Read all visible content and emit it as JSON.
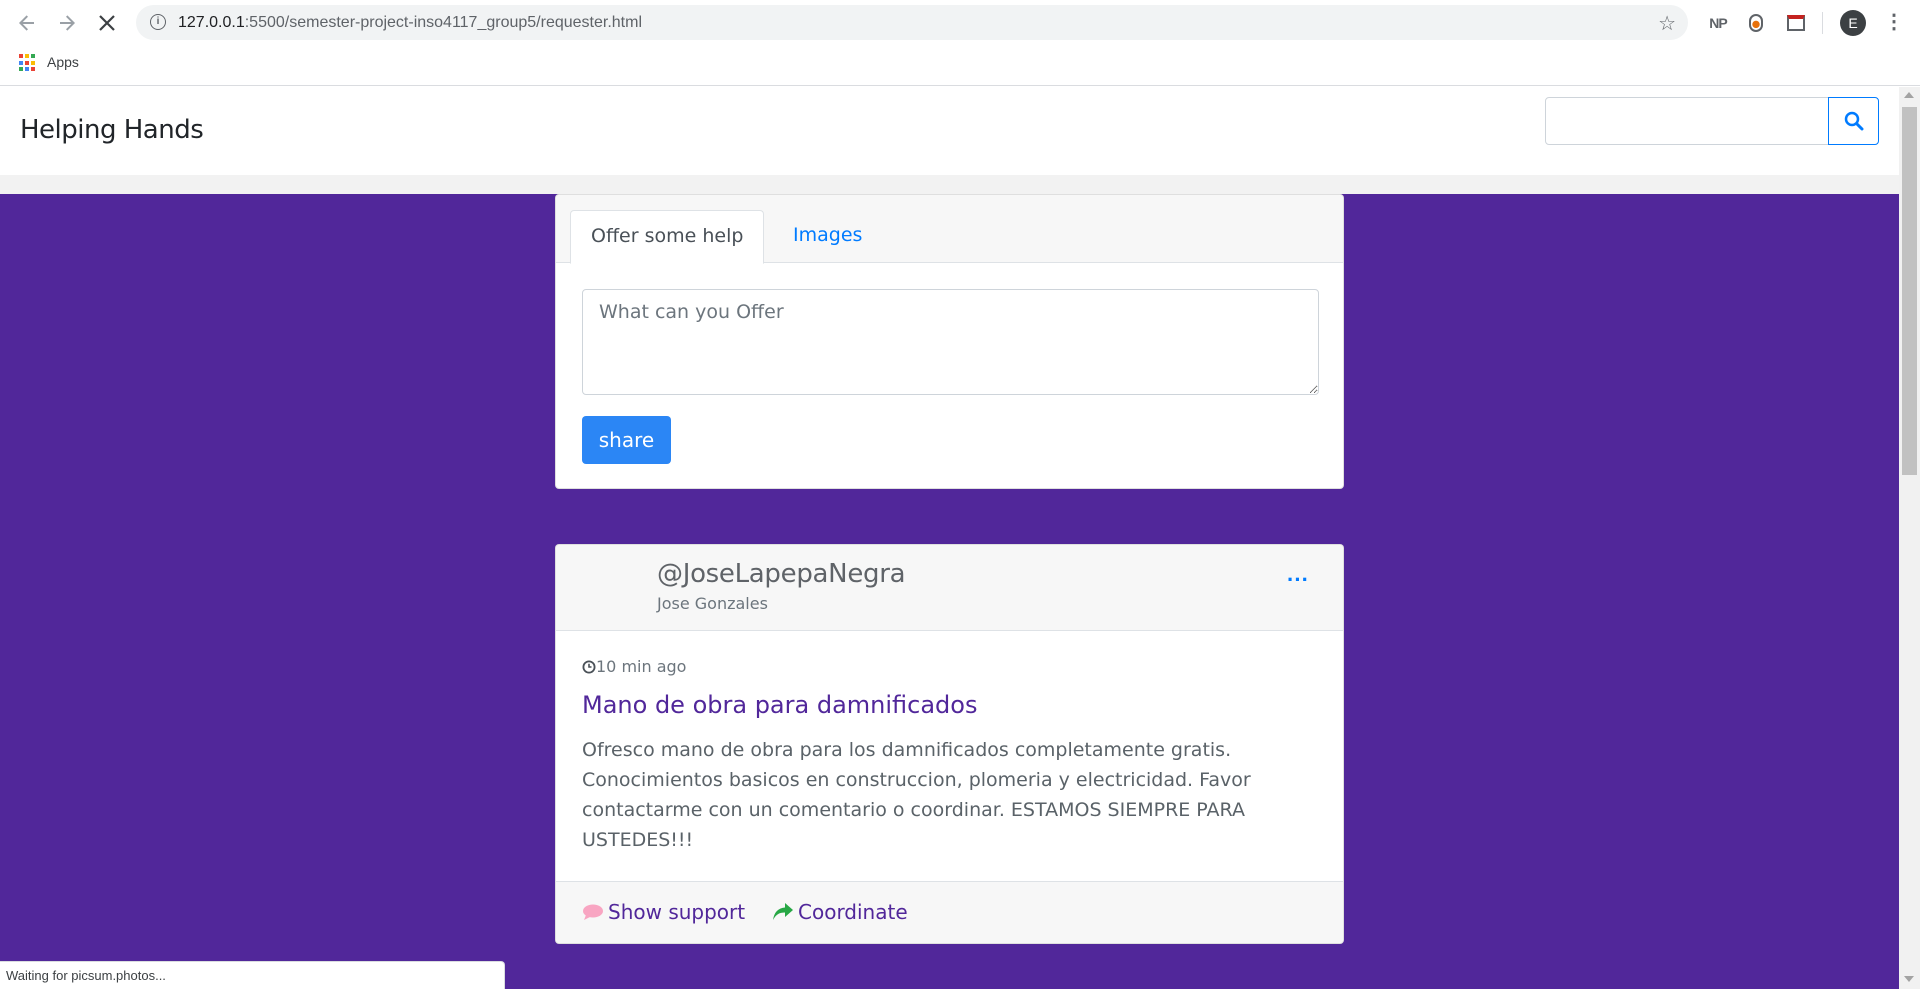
{
  "browser": {
    "url_host": "127.0.0.1",
    "url_path": ":5500/semester-project-inso4117_group5/requester.html",
    "bookmarks": {
      "apps_label": "Apps"
    },
    "extensions": {
      "np_label": "NP"
    },
    "profile_initial": "E",
    "status_text": "Waiting for picsum.photos..."
  },
  "header": {
    "brand": "Helping Hands",
    "search": {
      "placeholder": ""
    }
  },
  "compose": {
    "tabs": [
      {
        "label": "Offer some help",
        "active": true
      },
      {
        "label": "Images",
        "active": false
      }
    ],
    "textarea_placeholder": "What can you Offer",
    "share_label": "share"
  },
  "post": {
    "handle": "@JoseLapepaNegra",
    "full_name": "Jose Gonzales",
    "more_label": "···",
    "time_ago": "10 min ago",
    "title": "Mano de obra para damnificados",
    "body": "Ofresco mano de obra para los damnificados completamente gratis. Conocimientos basicos en construccion, plomeria y electricidad. Favor contactarme con un comentario o coordinar. ESTAMOS SIEMPRE PARA USTEDES!!!",
    "actions": {
      "support_label": "Show support",
      "coordinate_label": "Coordinate"
    }
  },
  "colors": {
    "brand_purple": "#51279a",
    "primary_blue": "#2b86f5",
    "link_blue": "#007bff",
    "support_icon": "#f8a5c2",
    "coordinate_icon": "#28a745"
  },
  "icons": {
    "back": "back-arrow-icon",
    "forward": "forward-arrow-icon",
    "stop": "stop-loading-icon",
    "info": "site-info-icon",
    "star": "bookmark-star-icon",
    "apps": "apps-grid-icon",
    "search": "search-icon",
    "clock": "clock-icon",
    "comment": "comment-icon",
    "share": "share-arrow-icon"
  }
}
